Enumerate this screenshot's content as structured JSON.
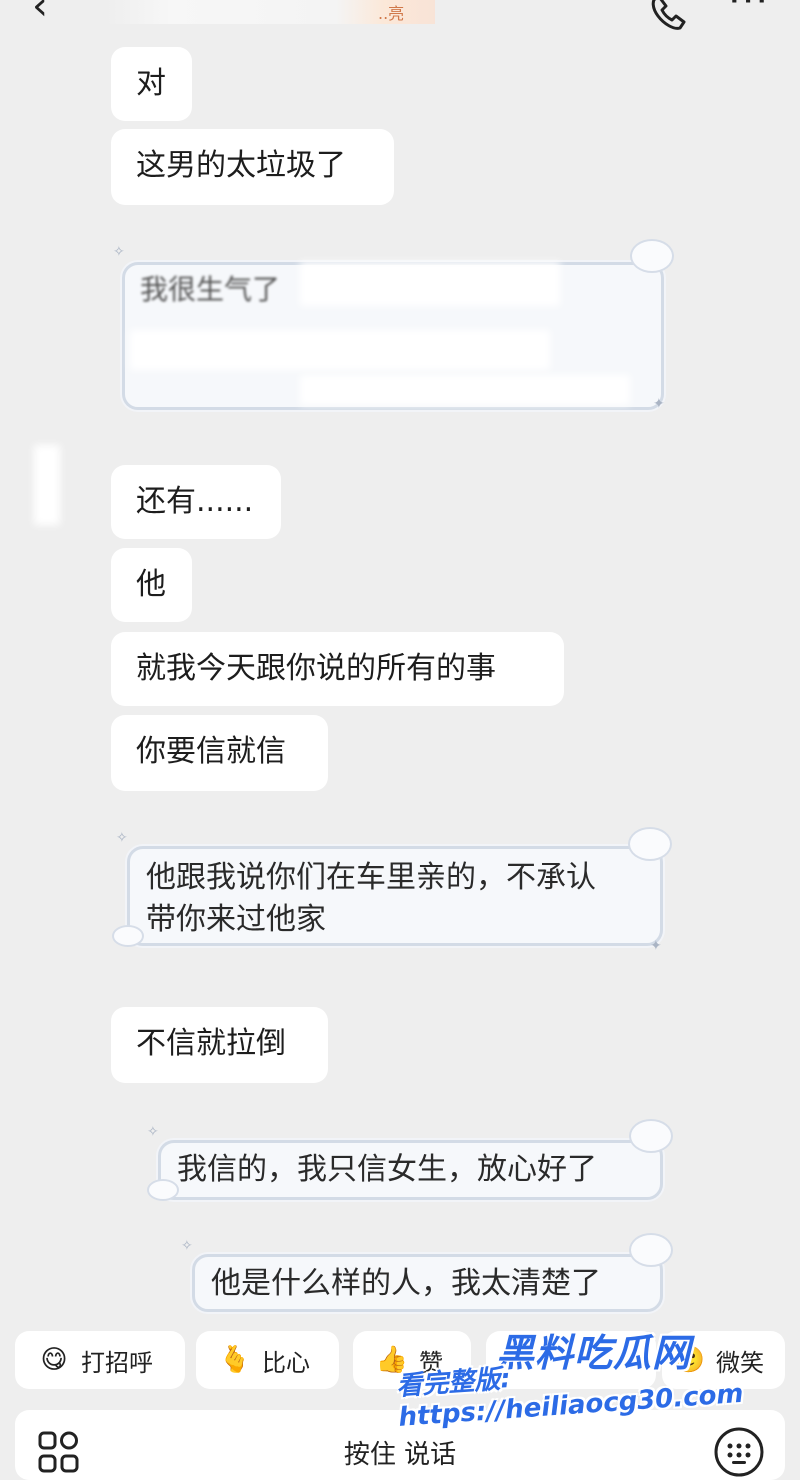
{
  "header": {
    "back_icon": "chevron-left-icon",
    "title_fragment": "..亮",
    "call_icon": "phone-icon",
    "more_label": "···"
  },
  "messages": {
    "m1": "对",
    "m2": "这男的太垃圾了",
    "m3_partial": "我很生气了",
    "m4": "还有......",
    "m5": "他",
    "m6": "就我今天跟你说的所有的事",
    "m7": "你要信就信",
    "m8_line1": "他跟我说你们在车里亲的，不承认",
    "m8_line2": "带你来过他家",
    "m9": "不信就拉倒",
    "m10": "我信的，我只信女生，放心好了",
    "m11": "他是什么样的人，我太清楚了"
  },
  "quick_replies": [
    {
      "label": "打招呼",
      "icon": "smile-emoji-icon"
    },
    {
      "label": "比心",
      "icon": "finger-heart-emoji-icon"
    },
    {
      "label": "赞",
      "icon": "thumbs-up-emoji-icon"
    },
    {
      "label": "微笑",
      "icon": "slight-smile-emoji-icon"
    }
  ],
  "input": {
    "hold_to_talk": "按住 说话",
    "left_icon": "apps-grid-icon",
    "right_icon": "keyboard-icon"
  },
  "watermark": {
    "line1": "黑料吃瓜网",
    "line2": "看完整版: https://heiliaocg30.com"
  },
  "colors": {
    "background": "#eeeeee",
    "bubble": "#ffffff",
    "deco_border": "#d3dbe6",
    "watermark": "#2c6be6"
  }
}
